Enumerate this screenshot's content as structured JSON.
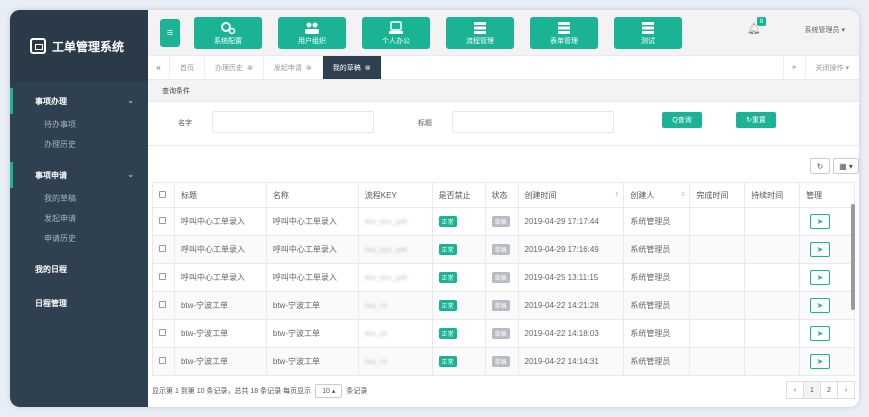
{
  "app": {
    "title": "工单管理系统"
  },
  "sidebar": {
    "groups": [
      {
        "label": "事项办理",
        "chevron": "⌄",
        "items": [
          "待办事项",
          "办理历史"
        ]
      },
      {
        "label": "事项申请",
        "chevron": "⌄",
        "items": [
          "我的草稿",
          "发起申请",
          "申请历史"
        ]
      },
      {
        "label": "我的日程",
        "chevron": "",
        "items": []
      },
      {
        "label": "日程管理",
        "chevron": "",
        "items": []
      }
    ]
  },
  "topbar": {
    "menu_icon": "hamburger-icon",
    "buttons": [
      {
        "label": "系统配置",
        "icon": "gears-icon"
      },
      {
        "label": "用户组织",
        "icon": "users-icon"
      },
      {
        "label": "个人办公",
        "icon": "desk-icon"
      },
      {
        "label": "流程管理",
        "icon": "server-icon"
      },
      {
        "label": "表单管理",
        "icon": "server-icon"
      },
      {
        "label": "测试",
        "icon": "server-icon"
      }
    ],
    "bell_badge": "8",
    "user_label": "系统管理员 ▾"
  },
  "tabs": {
    "left_arrow": "«",
    "right_arrow": "»",
    "items": [
      {
        "label": "首页",
        "closable": false,
        "active": false
      },
      {
        "label": "办理历史",
        "closable": true,
        "active": false
      },
      {
        "label": "发起申请",
        "closable": true,
        "active": false
      },
      {
        "label": "我的草稿",
        "closable": true,
        "active": true
      }
    ],
    "close_ops": "关闭操作 ▾"
  },
  "query": {
    "title": "查询条件",
    "name_label": "名字",
    "title_label": "标题",
    "search_label": "Q查询",
    "reset_label": "↻重置"
  },
  "toolbar": {
    "refresh": "↻",
    "columns": "▦ ▾"
  },
  "table": {
    "headers": [
      "标题",
      "名称",
      "流程KEY",
      "是否禁止",
      "状态",
      "创建时间",
      "创建人",
      "完成时间",
      "持续时间",
      "管理"
    ],
    "rows": [
      {
        "title": "呼叫中心工单录入",
        "name": "呼叫中心工单录入",
        "key": "btw_hjzx_gdlr",
        "disabled": "正常",
        "status": "草稿",
        "created": "2019-04-29 17:17:44",
        "creator": "系统管理员",
        "finished": "",
        "duration": ""
      },
      {
        "title": "呼叫中心工单录入",
        "name": "呼叫中心工单录入",
        "key": "btw_hjzx_gdlr",
        "disabled": "正常",
        "status": "草稿",
        "created": "2019-04-29 17:16:49",
        "creator": "系统管理员",
        "finished": "",
        "duration": ""
      },
      {
        "title": "呼叫中心工单录入",
        "name": "呼叫中心工单录入",
        "key": "btw_hjzx_gdlr",
        "disabled": "正常",
        "status": "草稿",
        "created": "2019-04-25 13:11:15",
        "creator": "系统管理员",
        "finished": "",
        "duration": ""
      },
      {
        "title": "btw-宁波工单",
        "name": "btw-宁波工单",
        "key": "btw_nb",
        "disabled": "正常",
        "status": "草稿",
        "created": "2019-04-22 14:21:28",
        "creator": "系统管理员",
        "finished": "",
        "duration": ""
      },
      {
        "title": "btw-宁波工单",
        "name": "btw-宁波工单",
        "key": "btw_nb",
        "disabled": "正常",
        "status": "草稿",
        "created": "2019-04-22 14:18:03",
        "creator": "系统管理员",
        "finished": "",
        "duration": ""
      },
      {
        "title": "btw-宁波工单",
        "name": "btw-宁波工单",
        "key": "btw_nb",
        "disabled": "正常",
        "status": "草稿",
        "created": "2019-04-22 14:14:31",
        "creator": "系统管理员",
        "finished": "",
        "duration": ""
      }
    ]
  },
  "footer": {
    "summary": "显示第 1 到第 10 条记录，总共 18 条记录 每页显示",
    "page_size": "10 ▴",
    "suffix": "条记录",
    "pager": [
      "‹",
      "1",
      "2",
      "›"
    ]
  }
}
